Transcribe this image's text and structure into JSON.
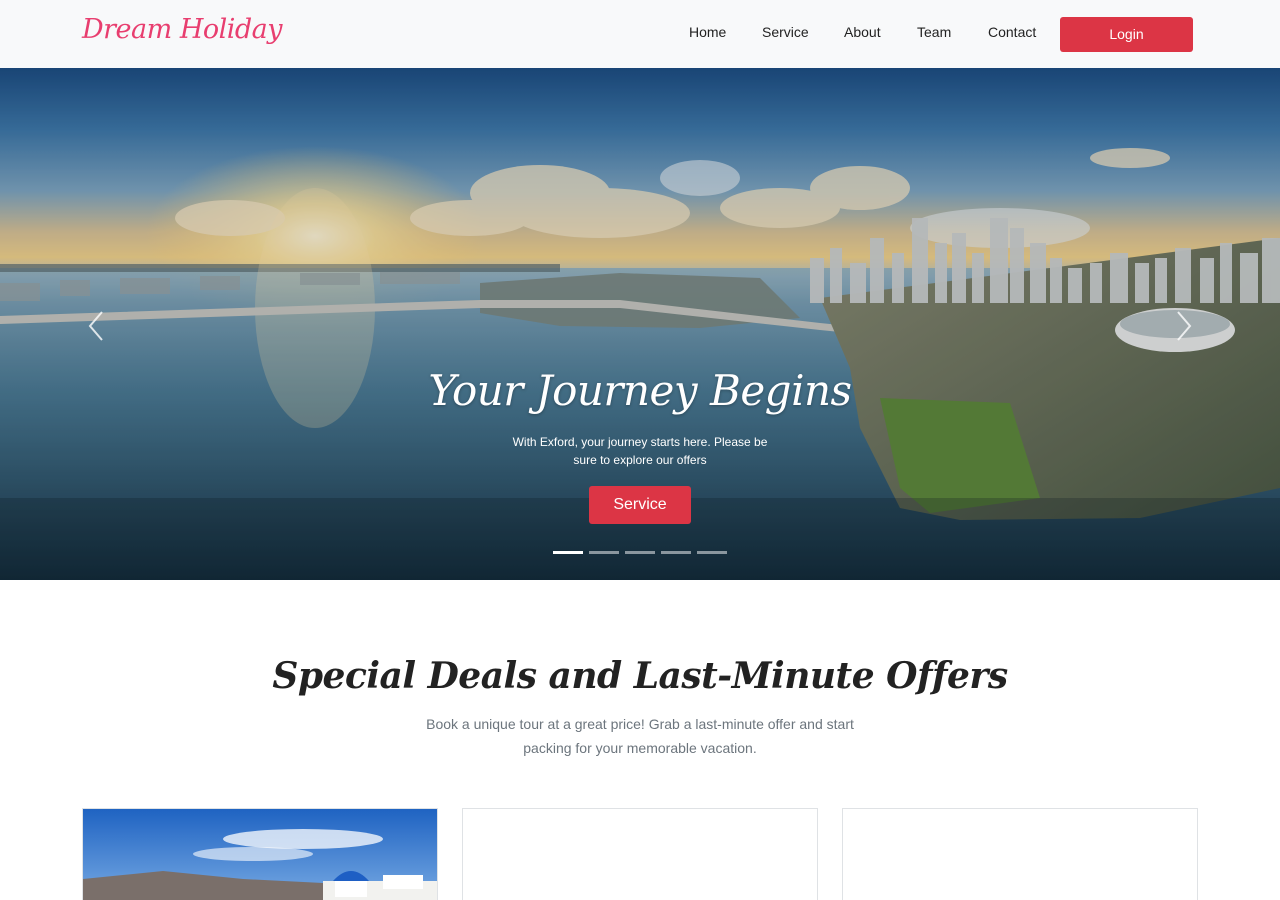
{
  "navbar": {
    "brand": "Dream Holiday",
    "links": [
      "Home",
      "Service",
      "About",
      "Team",
      "Contact"
    ],
    "login_label": "Login"
  },
  "hero": {
    "title": "Your Journey Begins",
    "subtitle": "With Exford, your journey starts here. Please be sure to explore our offers",
    "button_label": "Service",
    "slides_count": 5,
    "active_slide": 1
  },
  "deals": {
    "title": "Special Deals and Last-Minute Offers",
    "subtitle": "Book a unique tour at a great price! Grab a last-minute offer and start packing for your memorable vacation."
  },
  "colors": {
    "brand": "#e83e6f",
    "primary_button": "#dc3545",
    "navbar_bg": "#f8f9fa"
  },
  "icons": {
    "prev": "chevron-left-icon",
    "next": "chevron-right-icon"
  }
}
